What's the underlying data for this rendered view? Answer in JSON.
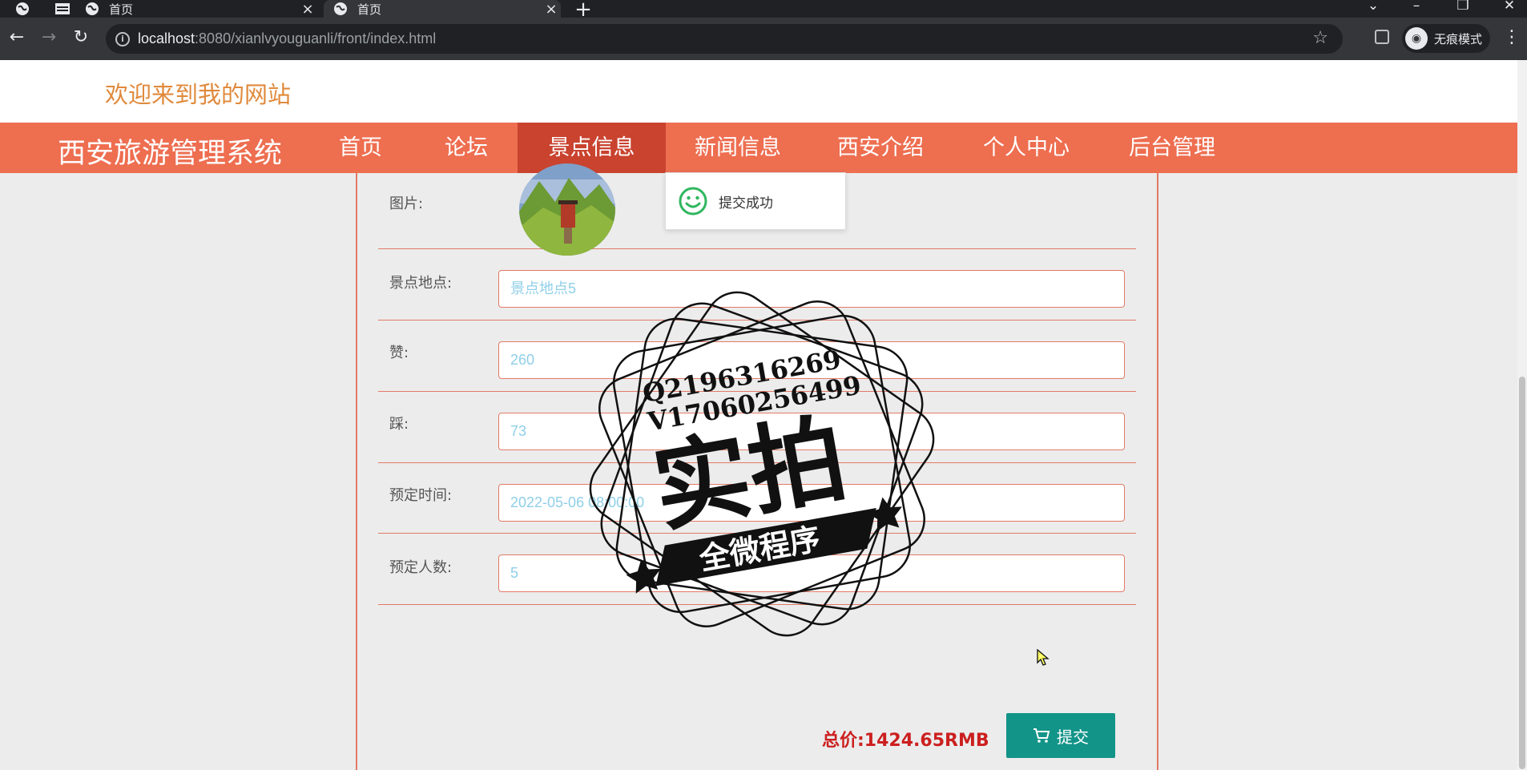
{
  "browser": {
    "tabs": [
      {
        "label": "首页"
      },
      {
        "label": "首页"
      }
    ],
    "url_host": "localhost",
    "url_path": ":8080/xianlvyouguanli/front/index.html",
    "incognito_label": "无痕模式"
  },
  "site": {
    "welcome": "欢迎来到我的网站",
    "brand": "西安旅游管理系统",
    "nav": [
      {
        "label": "首页",
        "active": false
      },
      {
        "label": "论坛",
        "active": false
      },
      {
        "label": "景点信息",
        "active": true
      },
      {
        "label": "新闻信息",
        "active": false
      },
      {
        "label": "西安介绍",
        "active": false
      },
      {
        "label": "个人中心",
        "active": false
      },
      {
        "label": "后台管理",
        "active": false
      }
    ]
  },
  "form": {
    "image_label": "图片:",
    "fields": [
      {
        "label": "景点地点:",
        "value": "景点地点5"
      },
      {
        "label": "赞:",
        "value": "260"
      },
      {
        "label": "踩:",
        "value": "73"
      },
      {
        "label": "预定时间:",
        "value": "2022-05-06 08:00:00"
      },
      {
        "label": "预定人数:",
        "value": "5"
      }
    ],
    "total": "总价:1424.65RMB",
    "submit_label": "提交"
  },
  "toast": {
    "message": "提交成功"
  },
  "watermark": {
    "line1": "Q2196316269",
    "line2": "V17060256499",
    "big": "实拍",
    "banner": "全微程序"
  },
  "colors": {
    "nav_bg": "#ee6e50",
    "nav_active": "#c9432f",
    "welcome": "#e08a3c",
    "submit": "#139488",
    "total": "#cc1f1f",
    "input_text": "#8fcfe8"
  }
}
